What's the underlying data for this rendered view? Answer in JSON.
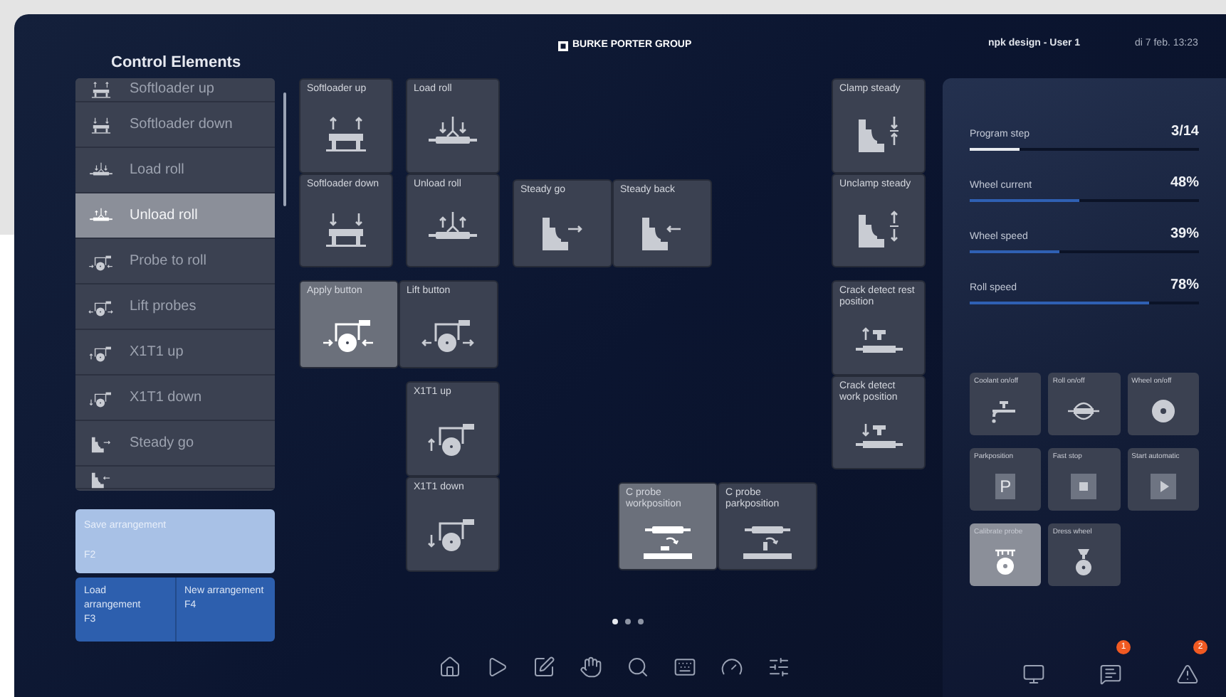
{
  "header": {
    "logo": "BURKE PORTER GROUP",
    "user": "npk design - User 1",
    "datetime": "di 7 feb. 13:23"
  },
  "sidebar": {
    "title": "Control Elements",
    "items": [
      {
        "label": "Softloader up",
        "selected": false
      },
      {
        "label": "Softloader down",
        "selected": false
      },
      {
        "label": "Load roll",
        "selected": false
      },
      {
        "label": "Unload roll",
        "selected": true
      },
      {
        "label": "Probe to roll",
        "selected": false
      },
      {
        "label": "Lift probes",
        "selected": false
      },
      {
        "label": "X1T1 up",
        "selected": false
      },
      {
        "label": "X1T1 down",
        "selected": false
      },
      {
        "label": "Steady go",
        "selected": false
      },
      {
        "selected": false
      }
    ]
  },
  "arrangement_buttons": [
    {
      "label": "Save arrangement",
      "key": "F2"
    },
    {
      "label": "Load arrangement",
      "key": "F3"
    },
    {
      "label": "New arrangement",
      "key": "F4"
    }
  ],
  "tiles": [
    {
      "label": "Softloader up",
      "selected": false
    },
    {
      "label": "Load roll",
      "selected": false
    },
    {
      "label": "Clamp steady",
      "selected": false
    },
    {
      "label": "Softloader down",
      "selected": false
    },
    {
      "label": "Unload roll",
      "selected": false
    },
    {
      "label": "Steady go",
      "selected": false
    },
    {
      "label": "Steady back",
      "selected": false
    },
    {
      "label": "Unclamp steady",
      "selected": false
    },
    {
      "label": "Apply button",
      "selected": true
    },
    {
      "label": "Lift button",
      "selected": false
    },
    {
      "label": "Crack detect rest position",
      "selected": false
    },
    {
      "label": "X1T1 up",
      "selected": false
    },
    {
      "label": "Crack detect work position",
      "selected": false
    },
    {
      "label": "X1T1 down",
      "selected": false
    },
    {
      "label": "C probe workposition",
      "selected": true
    },
    {
      "label": "C probe parkposition",
      "selected": false
    }
  ],
  "pager": [
    {
      "selected": true
    },
    {
      "selected": false
    },
    {
      "selected": false
    }
  ],
  "status": [
    {
      "label": "Program step",
      "value": "3/14",
      "level": 0.22,
      "kind": "step"
    },
    {
      "label": "Wheel current",
      "value": "48%",
      "level": 0.48,
      "kind": "gauge"
    },
    {
      "label": "Wheel speed",
      "value": "39%",
      "level": 0.39,
      "kind": "gauge"
    },
    {
      "label": "Roll speed",
      "value": "78%",
      "level": 0.78,
      "kind": "gauge"
    }
  ],
  "machine_buttons": [
    {
      "label": "Coolant on/off",
      "selected": false
    },
    {
      "label": "Roll on/off",
      "selected": false
    },
    {
      "label": "Wheel on/off",
      "selected": false
    },
    {
      "label": "Parkposition",
      "selected": false,
      "symbol": "P"
    },
    {
      "label": "Fast stop",
      "selected": false
    },
    {
      "label": "Start automatic",
      "selected": false
    },
    {
      "label": "Calibrate probe",
      "selected": true
    },
    {
      "label": "Dress wheel",
      "selected": false
    }
  ],
  "alerts": {
    "messages_badge": "1",
    "warnings_badge": "2"
  }
}
